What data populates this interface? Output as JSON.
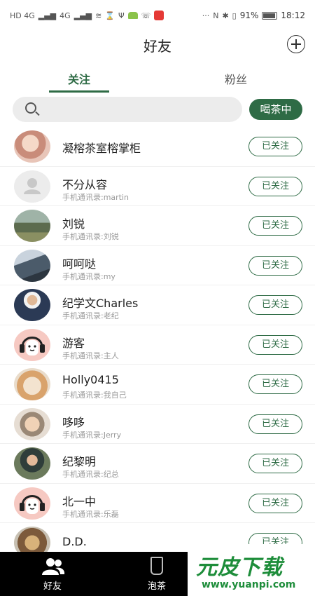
{
  "status_bar": {
    "battery": "91%",
    "time": "18:12",
    "signal_left": "HD 4G",
    "signal_right": "4G"
  },
  "header": {
    "title": "好友"
  },
  "tabs": [
    {
      "label": "关注"
    },
    {
      "label": "粉丝"
    }
  ],
  "search": {
    "placeholder": "",
    "tea_button": "喝茶中"
  },
  "contacts": [
    {
      "name": "凝榕茶室榕掌柜",
      "sub": "",
      "button": "已关注",
      "avatar": "photo-woman"
    },
    {
      "name": "不分从容",
      "sub": "手机通讯录:martin",
      "button": "已关注",
      "avatar": "default-person"
    },
    {
      "name": "刘锐",
      "sub": "手机通讯录:刘锐",
      "button": "已关注",
      "avatar": "photo-landscape"
    },
    {
      "name": "呵呵哒",
      "sub": "手机通讯录:my",
      "button": "已关注",
      "avatar": "photo-night-street"
    },
    {
      "name": "纪学文Charles",
      "sub": "手机通讯录:老纪",
      "button": "已关注",
      "avatar": "photo-man-suit"
    },
    {
      "name": "游客",
      "sub": "手机通讯录:主人",
      "button": "已关注",
      "avatar": "cartoon-headphones"
    },
    {
      "name": "Holly0415",
      "sub": "手机通讯录:我自己",
      "button": "已关注",
      "avatar": "photo-cat"
    },
    {
      "name": "哆哆",
      "sub": "手机通讯录:Jerry",
      "button": "已关注",
      "avatar": "photo-glasses"
    },
    {
      "name": "纪黎明",
      "sub": "手机通讯录:纪总",
      "button": "已关注",
      "avatar": "photo-man-indoor"
    },
    {
      "name": "北一中",
      "sub": "手机通讯录:乐磊",
      "button": "已关注",
      "avatar": "cartoon-headphones"
    },
    {
      "name": "D.D.",
      "sub": "",
      "button": "已关注",
      "avatar": "photo-food"
    }
  ],
  "bottom_nav": [
    {
      "label": "好友",
      "icon": "people-icon"
    },
    {
      "label": "泡茶",
      "icon": "cup-icon"
    }
  ],
  "watermark": {
    "brand": "元皮下载",
    "url": "www.yuanpi.com"
  },
  "colors": {
    "accent": "#2e6b45",
    "nav_bg": "#000000"
  }
}
